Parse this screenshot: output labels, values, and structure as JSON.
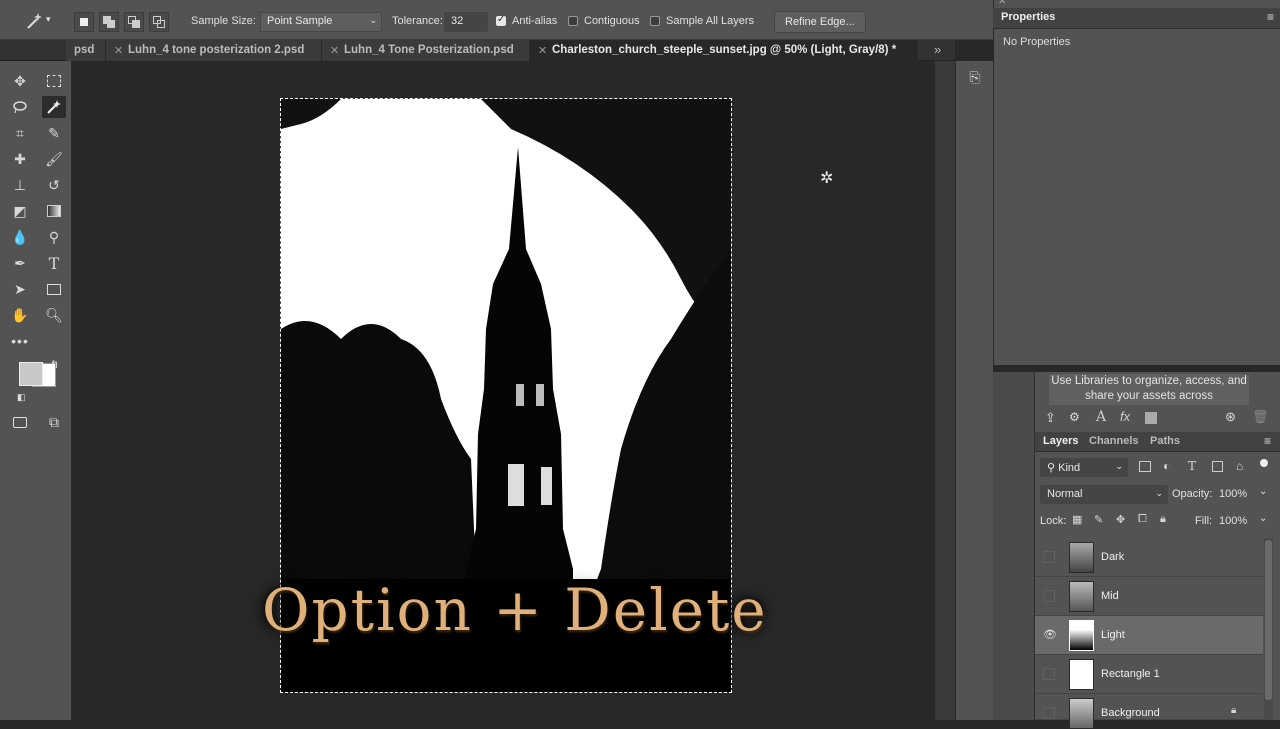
{
  "options_bar": {
    "sample_size_label": "Sample Size:",
    "sample_size_value": "Point Sample",
    "tolerance_label": "Tolerance:",
    "tolerance_value": "32",
    "anti_alias_label": "Anti-alias",
    "contiguous_label": "Contiguous",
    "sample_all_label": "Sample All Layers",
    "refine_edge_label": "Refine Edge..."
  },
  "tabs": [
    {
      "label": "psd"
    },
    {
      "label": "Luhn_4 tone posterization 2.psd"
    },
    {
      "label": "Luhn_4 Tone Posterization.psd"
    },
    {
      "label": "Charleston_church_steeple_sunset.jpg @ 50% (Light, Gray/8) *"
    }
  ],
  "tabs_overflow": "»",
  "overlay_caption": "Option + Delete",
  "properties": {
    "title": "Properties",
    "empty_text": "No Properties"
  },
  "libraries": {
    "message": "Use Libraries to organize, access, and share your assets across"
  },
  "layers_panel": {
    "tabs": [
      "Layers",
      "Channels",
      "Paths"
    ],
    "filter_value": "Kind",
    "blend_mode": "Normal",
    "opacity_label": "Opacity:",
    "opacity_value": "100%",
    "lock_label": "Lock:",
    "fill_label": "Fill:",
    "fill_value": "100%",
    "layers": [
      {
        "name": "Dark",
        "visible": false,
        "selected": false
      },
      {
        "name": "Mid",
        "visible": false,
        "selected": false
      },
      {
        "name": "Light",
        "visible": true,
        "selected": true
      },
      {
        "name": "Rectangle 1",
        "visible": false,
        "selected": false
      },
      {
        "name": "Background",
        "visible": false,
        "selected": false
      }
    ]
  },
  "colors": {
    "foreground": "#c8c8c8",
    "background": "#ffffff",
    "caption": "#e0b07a"
  }
}
